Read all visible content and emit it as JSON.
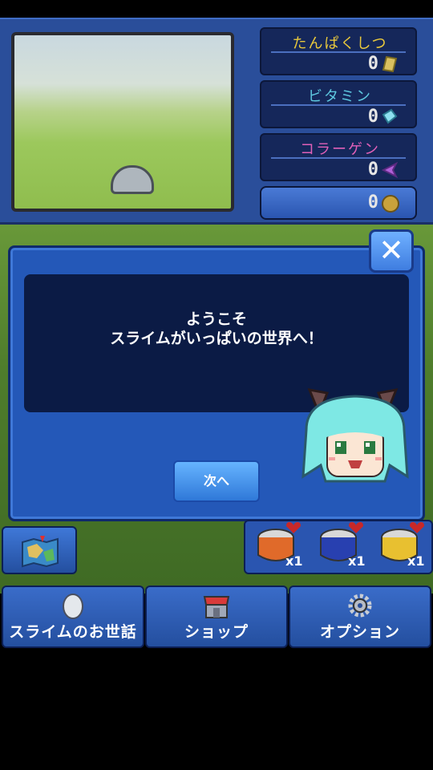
{
  "resources": [
    {
      "label": "たんぱくしつ",
      "value": "0",
      "color": "#e8c83c",
      "icon": "protein-gem-icon"
    },
    {
      "label": "ビタミン",
      "value": "0",
      "color": "#5ec8e0",
      "icon": "vitamin-gem-icon"
    },
    {
      "label": "コラーゲン",
      "value": "0",
      "color": "#e060b8",
      "icon": "collagen-gem-icon"
    }
  ],
  "coins": {
    "value": "0",
    "icon": "coin-icon"
  },
  "dialog": {
    "line1": "ようこそ",
    "line2": "スライムがいっぱいの世界へ！",
    "next_label": "次へ",
    "close_icon": "close-icon"
  },
  "items": [
    {
      "count": "x1",
      "color": "#e06a2a"
    },
    {
      "count": "x1",
      "color": "#2840b0"
    },
    {
      "count": "x1",
      "color": "#e8c030"
    }
  ],
  "nav": [
    {
      "label": "スライムのお世話",
      "icon": "egg-icon"
    },
    {
      "label": "ショップ",
      "icon": "shop-icon"
    },
    {
      "label": "オプション",
      "icon": "gear-icon"
    }
  ]
}
